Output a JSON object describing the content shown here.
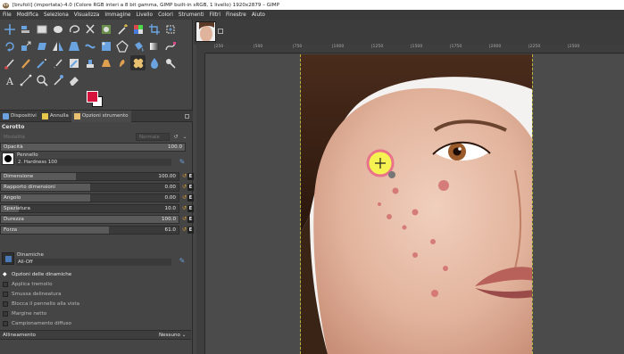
{
  "window": {
    "title": "[brufoli] (importata)-4.0 (Colore RGB interi a 8 bit gamma, GIMP built-in sRGB, 1 livello) 1920x2879 – GIMP"
  },
  "menu": [
    "File",
    "Modifica",
    "Seleziona",
    "Visualizza",
    "Immagine",
    "Livello",
    "Colori",
    "Strumenti",
    "Filtri",
    "Finestre",
    "Aiuto"
  ],
  "colors": {
    "foreground": "#d6133c",
    "background": "#ffffff"
  },
  "tabs": [
    {
      "label": "Dispositivi",
      "icon": "devices-icon"
    },
    {
      "label": "Annulla",
      "icon": "undo-history-icon"
    },
    {
      "label": "Opzioni strumento",
      "icon": "tool-options-icon"
    }
  ],
  "options": {
    "title": "Cerotto",
    "mode_label": "Modalità",
    "mode_value": "Normale",
    "opacity": {
      "label": "Opacità",
      "value": "100.0"
    },
    "brush": {
      "label": "Pennello",
      "name": "2. Hardness 100"
    },
    "sliders": [
      {
        "label": "Dimensione",
        "value": "100.00",
        "fill": 0.42
      },
      {
        "label": "Rapporto dimensioni",
        "value": "0.00",
        "fill": 0.5
      },
      {
        "label": "Angolo",
        "value": "0.00",
        "fill": 0.5
      },
      {
        "label": "Spaziatura",
        "value": "10.0",
        "fill": 0.1
      },
      {
        "label": "Durezza",
        "value": "100.0",
        "fill": 1.0
      },
      {
        "label": "Forza",
        "value": "61.0",
        "fill": 0.61
      }
    ],
    "dynamics": {
      "label": "Dinamiche",
      "value": "All-Off"
    },
    "dynamics_options": "Opzioni delle dinamiche",
    "checks": [
      {
        "label": "Applica tremolio",
        "checked": false
      },
      {
        "label": "Smussa delineatura",
        "checked": false
      },
      {
        "label": "Blocca il pennello alla vista",
        "checked": false
      },
      {
        "label": "Margine netto",
        "checked": false
      },
      {
        "label": "Campionamento diffuso",
        "checked": false
      }
    ],
    "alignment": {
      "label": "Allineamento",
      "value": "Nessuno"
    }
  },
  "rulers": {
    "h": [
      "|250",
      "|500",
      "|750",
      "|1000",
      "|1250",
      "|1500",
      "|1750",
      "|2000",
      "|2250",
      "|2500"
    ]
  }
}
